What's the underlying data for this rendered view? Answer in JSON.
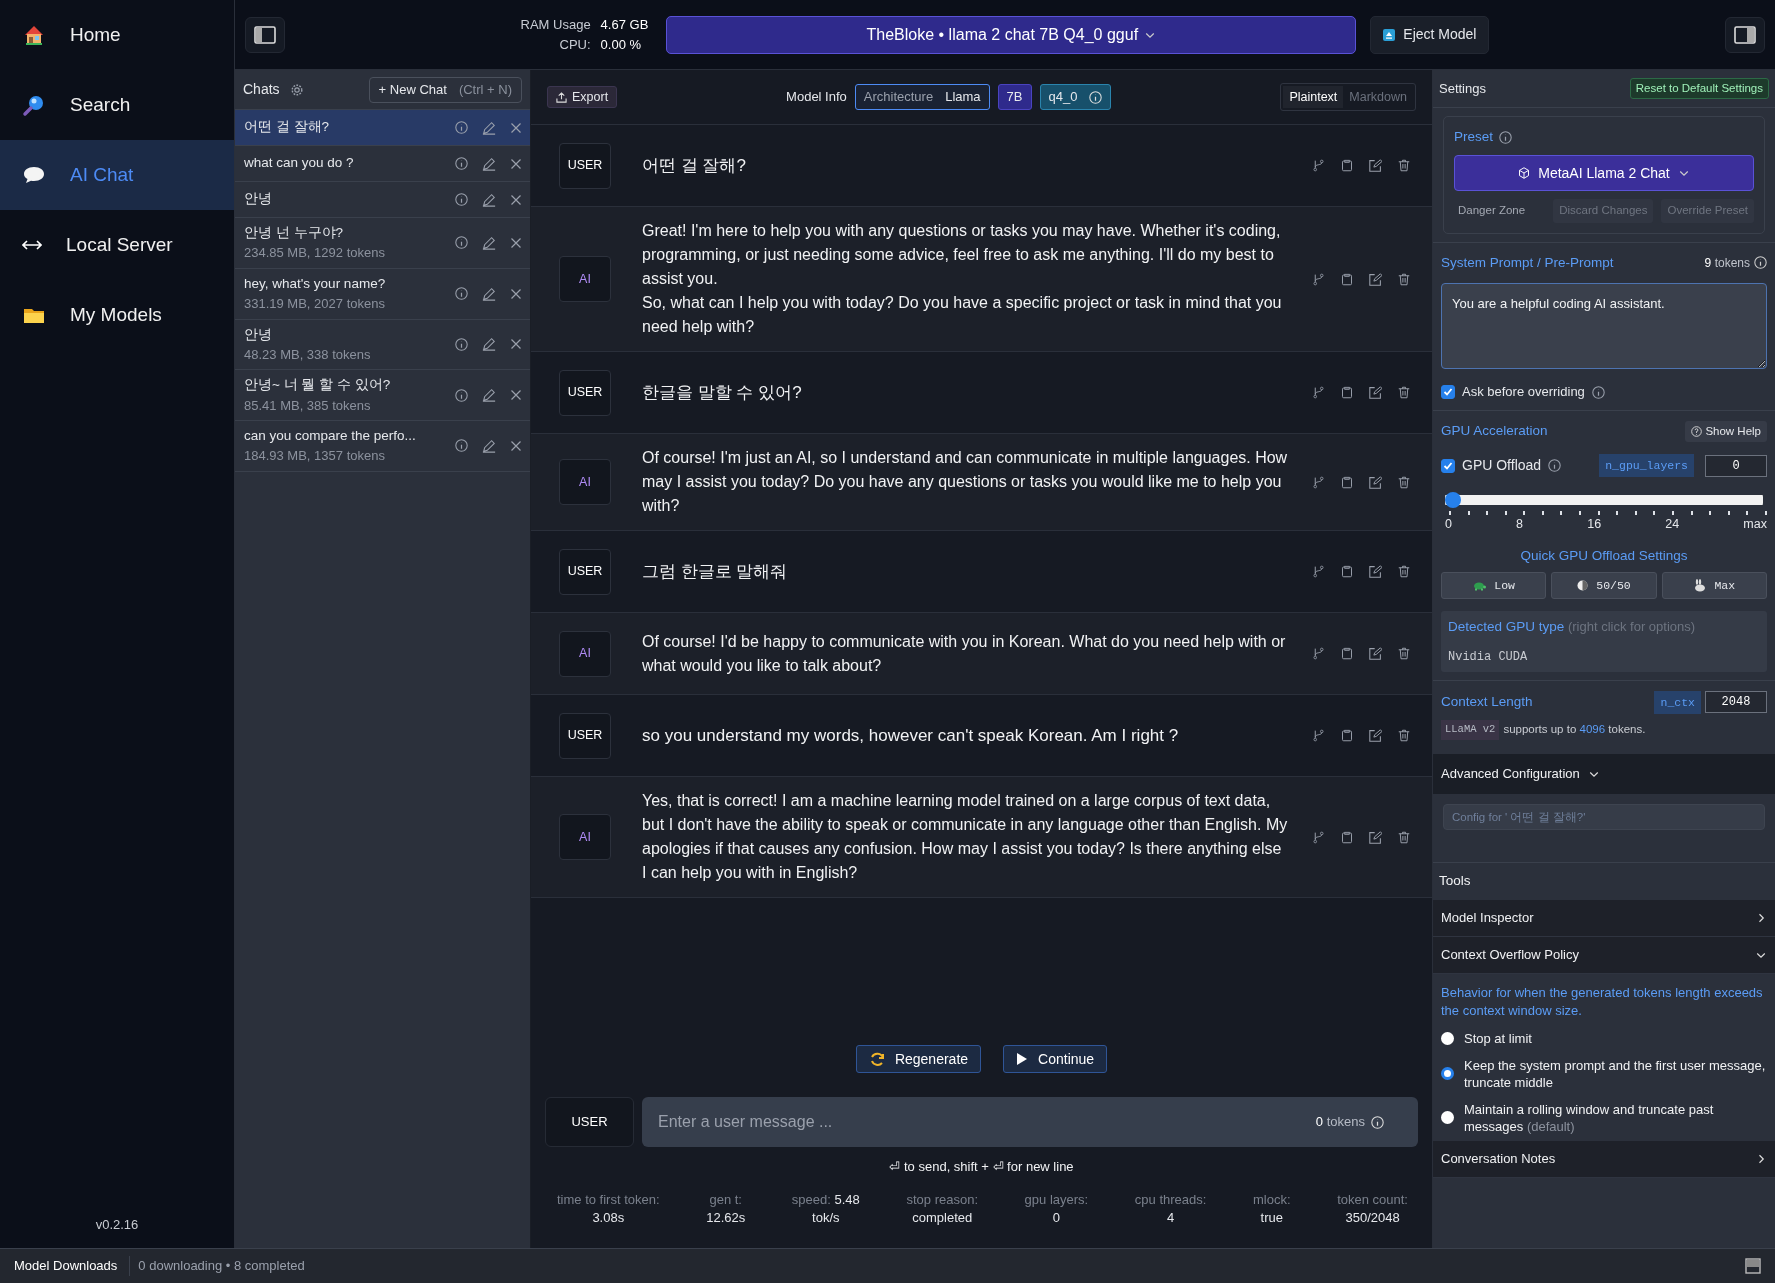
{
  "nav": {
    "items": [
      {
        "label": "Home",
        "selected": false
      },
      {
        "label": "Search",
        "selected": false
      },
      {
        "label": "AI Chat",
        "selected": true
      },
      {
        "label": "Local Server",
        "selected": false
      },
      {
        "label": "My Models",
        "selected": false
      }
    ],
    "version": "v0.2.16"
  },
  "topbar": {
    "ram_label": "RAM Usage",
    "ram_value": "4.67 GB",
    "cpu_label": "CPU:",
    "cpu_value": "0.00 %",
    "model": "TheBloke • llama 2 chat 7B Q4_0 gguf",
    "eject": "Eject Model"
  },
  "chats": {
    "title": "Chats",
    "new_chat": "+ New Chat",
    "shortcut": "(Ctrl + N)",
    "items": [
      {
        "title": "어떤 걸 잘해?",
        "selected": true
      },
      {
        "title": "what can you do ?",
        "selected": false
      },
      {
        "title": "안녕",
        "selected": false
      },
      {
        "title": "안녕 넌 누구야?",
        "meta": "234.85 MB, 1292 tokens",
        "selected": false
      },
      {
        "title": "hey, what's your name?",
        "meta": "331.19 MB, 2027 tokens",
        "selected": false
      },
      {
        "title": "안녕",
        "meta": "48.23 MB, 338 tokens",
        "selected": false
      },
      {
        "title": "안녕~ 너 뭘 할 수 있어?",
        "meta": "85.41 MB, 385 tokens",
        "selected": false
      },
      {
        "title": "can you compare the perfo...",
        "meta": "184.93 MB, 1357 tokens",
        "selected": false
      }
    ]
  },
  "toolbar": {
    "export": "Export",
    "model_info": "Model Info",
    "arch_label": "Architecture",
    "arch_value": "Llama",
    "size": "7B",
    "quant": "q4_0",
    "formats": [
      {
        "label": "Plaintext",
        "selected": true
      },
      {
        "label": "Markdown",
        "selected": false
      }
    ]
  },
  "messages": [
    {
      "kind": "user",
      "role": "USER",
      "text": "어떤 걸 잘해?"
    },
    {
      "kind": "ai",
      "role": "AI",
      "text": "Great! I'm here to help you with any questions or tasks you may have. Whether it's coding, programming, or just needing some advice, feel free to ask me anything. I'll do my best to assist you.\nSo, what can I help you with today? Do you have a specific project or task in mind that you need help with?"
    },
    {
      "kind": "user",
      "role": "USER",
      "text": "한글을 말할 수 있어?"
    },
    {
      "kind": "ai",
      "role": "AI",
      "text": "Of course! I'm just an AI, so I understand and can communicate in multiple languages. How may I assist you today? Do you have any questions or tasks you would like me to help you with?"
    },
    {
      "kind": "user",
      "role": "USER",
      "text": "그럼 한글로 말해줘"
    },
    {
      "kind": "ai",
      "role": "AI",
      "text": "Of course! I'd be happy to communicate with you in Korean. What do you need help with or what would you like to talk about?"
    },
    {
      "kind": "user",
      "role": "USER",
      "text": "so you understand my words, however can't speak Korean. Am I right ?"
    },
    {
      "kind": "ai",
      "role": "AI",
      "text": "Yes, that is correct! I am a machine learning model trained on a large corpus of text data, but I don't have the ability to speak or communicate in any language other than English. My apologies if that causes any confusion. How may I assist you today? Is there anything else I can help you with in English?"
    }
  ],
  "actions": [
    "Regenerate",
    "Continue"
  ],
  "composer": {
    "role": "USER",
    "placeholder": "Enter a user message ...",
    "tokens_count": "0",
    "tokens_label": "tokens",
    "hint": "⏎ to send, shift + ⏎ for new line"
  },
  "stats": [
    {
      "label": "time to first token:",
      "value": "3.08s"
    },
    {
      "label": "gen t:",
      "value": "12.62s"
    },
    {
      "label": "speed:",
      "value": "5.48",
      "unit": "tok/s"
    },
    {
      "label": "stop reason:",
      "value": "completed"
    },
    {
      "label": "gpu layers:",
      "value": "0"
    },
    {
      "label": "cpu threads:",
      "value": "4"
    },
    {
      "label": "mlock:",
      "value": "true"
    },
    {
      "label": "token count:",
      "value": "350/2048"
    }
  ],
  "settings": {
    "title": "Settings",
    "reset": "Reset to Default Settings",
    "preset": {
      "label": "Preset",
      "value": "MetaAI Llama 2 Chat",
      "danger_label": "Danger Zone",
      "danger_buttons": [
        "Discard Changes",
        "Override Preset"
      ]
    },
    "system_prompt": {
      "title": "System Prompt / Pre-Prompt",
      "tokens_count": "9",
      "tokens_label": "tokens",
      "value": "You are a helpful coding AI assistant.",
      "ask_label": "Ask before overriding",
      "ask_checked": true
    },
    "gpu": {
      "title": "GPU Acceleration",
      "help": "Show Help",
      "offload_label": "GPU Offload",
      "offload_checked": true,
      "param": "n_gpu_layers",
      "param_value": "0",
      "level": 0,
      "ticks": [
        "0",
        "8",
        "16",
        "24",
        "max"
      ],
      "quick_title": "Quick GPU Offload Settings",
      "quick": [
        "Low",
        "50/50",
        "Max"
      ],
      "detected_label": "Detected GPU type",
      "detected_hint": "(right click for options)",
      "detected_value": "Nvidia CUDA"
    },
    "context": {
      "title": "Context Length",
      "param": "n_ctx",
      "value": "2048",
      "model_tag": "LLaMA v2",
      "note": [
        "supports up to",
        "4096",
        "tokens."
      ]
    },
    "advanced": {
      "title": "Advanced Configuration",
      "expanded": true,
      "config_placeholder": "Config for ' 어떤 걸 잘해?'"
    },
    "tools": {
      "title": "Tools",
      "sections": [
        {
          "title": "Model Inspector",
          "expanded": false
        },
        {
          "title": "Context Overflow Policy",
          "expanded": true
        },
        {
          "title": "Conversation Notes",
          "expanded": false
        }
      ]
    },
    "overflow": {
      "description": "Behavior for when the generated tokens length exceeds the context window size.",
      "options": [
        {
          "label": "Stop at limit",
          "selected": false
        },
        {
          "label": "Keep the system prompt and the first user message, truncate middle",
          "selected": true
        },
        {
          "label": "Maintain a rolling window and truncate past messages",
          "note": "(default)",
          "selected": false
        }
      ]
    }
  },
  "status_bar": {
    "title": "Model Downloads",
    "text": "0 downloading • 8 completed"
  }
}
